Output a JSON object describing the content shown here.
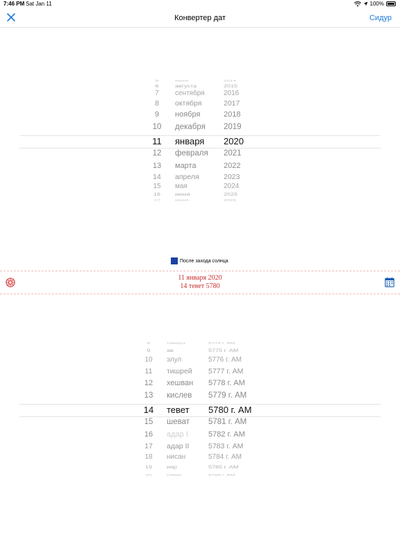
{
  "status_bar": {
    "time": "7:46 PM",
    "date": "Sat Jan 11",
    "battery": "100%"
  },
  "nav": {
    "title": "Конвертер дат",
    "right_button": "Сидур"
  },
  "gregorian_picker": {
    "days": [
      "5",
      "6",
      "7",
      "8",
      "9",
      "10",
      "11",
      "12",
      "13",
      "14",
      "15",
      "16",
      "17"
    ],
    "months": [
      "июня",
      "августа",
      "сентября",
      "октября",
      "ноября",
      "декабря",
      "января",
      "февраля",
      "марта",
      "апреля",
      "мая",
      "июня",
      "июня"
    ],
    "years": [
      "2014",
      "2015",
      "2016",
      "2017",
      "2018",
      "2019",
      "2020",
      "2021",
      "2022",
      "2023",
      "2024",
      "2025",
      "2026"
    ],
    "selected": {
      "day": "11",
      "month": "января",
      "year": "2020"
    }
  },
  "legend": {
    "label": "После захода солнца",
    "color": "#1a41a4"
  },
  "result": {
    "gregorian": "11 января 2020",
    "hebrew": "14 тевет 5780"
  },
  "hebrew_picker": {
    "days": [
      "8",
      "9",
      "10",
      "11",
      "12",
      "13",
      "14",
      "15",
      "16",
      "17",
      "18",
      "19",
      "20"
    ],
    "months": [
      "таммуз",
      "ав",
      "элул",
      "тишрей",
      "хешван",
      "кислев",
      "тевет",
      "шеват",
      "адар I",
      "адар II",
      "нисан",
      "ияр",
      "сиван"
    ],
    "years": [
      "5774 г. AM",
      "5775 г. AM",
      "5776 г. AM",
      "5777 г. AM",
      "5778 г. AM",
      "5779 г. AM",
      "5780 г. AM",
      "5781 г. AM",
      "5782 г. AM",
      "5783 г. AM",
      "5784 г. AM",
      "5785 г. AM",
      "5786 г. AM"
    ],
    "selected": {
      "day": "14",
      "month": "тевет",
      "year": "5780 г. AM"
    },
    "disabled_months": [
      "адар I"
    ]
  }
}
